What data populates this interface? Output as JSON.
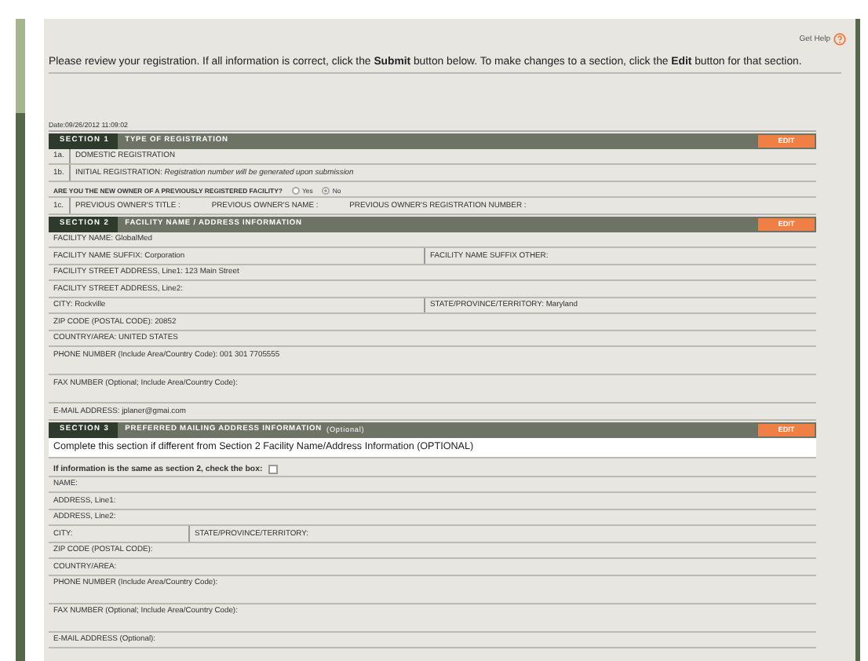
{
  "help_link": {
    "label": "Get Help"
  },
  "intro": "Please review your registration. If all information is correct, click the **Submit** button below. To make changes to a section, click the **Edit** button for that section.",
  "date": "Date:09/26/2012 11:09:02",
  "sections": [
    {
      "number": "SECTION 1",
      "title": "TYPE OF REGISTRATION",
      "edit": "EDIT",
      "rows": [
        {
          "kind": "coded",
          "code": "1a.",
          "cells": [
            "DOMESTIC REGISTRATION"
          ]
        },
        {
          "kind": "coded",
          "code": "1b.",
          "cells": [
            "INITIAL REGISTRATION: *Registration number will be generated upon submission*"
          ]
        },
        {
          "kind": "question",
          "text": "ARE YOU THE NEW OWNER OF A PREVIOUSLY REGISTERED FACILITY?",
          "options": [
            {
              "label": "Yes",
              "selected": false
            },
            {
              "label": "No",
              "selected": true
            }
          ]
        },
        {
          "kind": "coded",
          "code": "1c.",
          "cells": [
            "PREVIOUS OWNER'S TITLE :",
            "PREVIOUS OWNER'S NAME :",
            "PREVIOUS OWNER'S REGISTRATION NUMBER :"
          ]
        }
      ]
    },
    {
      "number": "SECTION 2",
      "title": "FACILITY NAME / ADDRESS INFORMATION",
      "edit": "EDIT",
      "rows": [
        {
          "kind": "field",
          "cells": [
            "FACILITY NAME: GlobalMed"
          ]
        },
        {
          "kind": "pair",
          "cells": [
            "FACILITY NAME SUFFIX: Corporation",
            "FACILITY NAME SUFFIX OTHER:"
          ]
        },
        {
          "kind": "field",
          "cells": [
            "FACILITY STREET ADDRESS, Line1: 123 Main Street"
          ]
        },
        {
          "kind": "field",
          "cells": [
            "FACILITY STREET ADDRESS, Line2:"
          ]
        },
        {
          "kind": "pair",
          "cells": [
            "CITY:  Rockville",
            "STATE/PROVINCE/TERRITORY: Maryland"
          ]
        },
        {
          "kind": "field",
          "cells": [
            "ZIP CODE (POSTAL CODE): 20852"
          ]
        },
        {
          "kind": "field",
          "cells": [
            "COUNTRY/AREA: UNITED STATES"
          ]
        },
        {
          "kind": "tall",
          "cells": [
            "PHONE NUMBER (Include Area/Country Code): 001 301 7705555"
          ]
        },
        {
          "kind": "tall",
          "cells": [
            "FAX NUMBER (Optional; Include Area/Country Code):"
          ]
        },
        {
          "kind": "field",
          "cells": [
            "E-MAIL ADDRESS: jplaner@gmai.com"
          ]
        }
      ]
    },
    {
      "number": "SECTION 3",
      "title": "PREFERRED MAILING ADDRESS INFORMATION",
      "title_note": "(Optional)",
      "edit": "EDIT",
      "rows": [
        {
          "kind": "note",
          "cells": [
            "Complete this section if different from Section 2 Facility Name/Address Information (OPTIONAL)"
          ]
        },
        {
          "kind": "checkbox",
          "text": "If information is the same as section 2, check the box:",
          "checked": false
        },
        {
          "kind": "field",
          "cells": [
            "NAME:"
          ]
        },
        {
          "kind": "field",
          "cells": [
            "ADDRESS, Line1:"
          ]
        },
        {
          "kind": "field",
          "cells": [
            "ADDRESS, Line2:"
          ]
        },
        {
          "kind": "pair_narrow",
          "cells": [
            "CITY:",
            "STATE/PROVINCE/TERRITORY:"
          ]
        },
        {
          "kind": "field",
          "cells": [
            "ZIP CODE (POSTAL CODE):"
          ]
        },
        {
          "kind": "field",
          "cells": [
            "COUNTRY/AREA:"
          ]
        },
        {
          "kind": "tall",
          "cells": [
            "PHONE NUMBER (Include Area/Country Code):"
          ]
        },
        {
          "kind": "tall",
          "cells": [
            "FAX NUMBER (Optional; Include Area/Country Code):"
          ]
        },
        {
          "kind": "field",
          "cells": [
            "E-MAIL ADDRESS (Optional):"
          ]
        }
      ]
    }
  ]
}
